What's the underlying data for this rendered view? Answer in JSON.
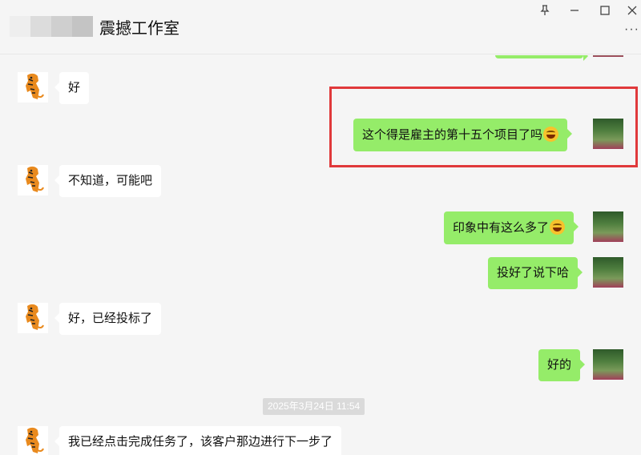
{
  "header": {
    "title": "震撼工作室",
    "controls": {
      "pin": "pin-icon",
      "minimize": "minimize-icon",
      "maximize": "maximize-icon",
      "close": "close-icon",
      "more": "more-icon"
    }
  },
  "messages": [
    {
      "side": "left",
      "text": "好"
    },
    {
      "side": "right",
      "text": "这个得是雇主的第十五个项目了吗",
      "emoji": "laughing-emoji",
      "highlighted": true
    },
    {
      "side": "left",
      "text": "不知道，可能吧"
    },
    {
      "side": "right",
      "text": "印象中有这么多了",
      "emoji": "grinning-emoji"
    },
    {
      "side": "right",
      "text": "投好了说下哈"
    },
    {
      "side": "left",
      "text": "好，已经投标了"
    },
    {
      "side": "right",
      "text": "好的"
    },
    {
      "side": "left",
      "text": "我已经点击完成任务了，该客户那边进行下一步了"
    }
  ],
  "timestamp": "2025年3月24日 11:54",
  "colors": {
    "green_bubble": "#95ec69",
    "highlight": "#e0393b",
    "background": "#f5f5f5"
  }
}
